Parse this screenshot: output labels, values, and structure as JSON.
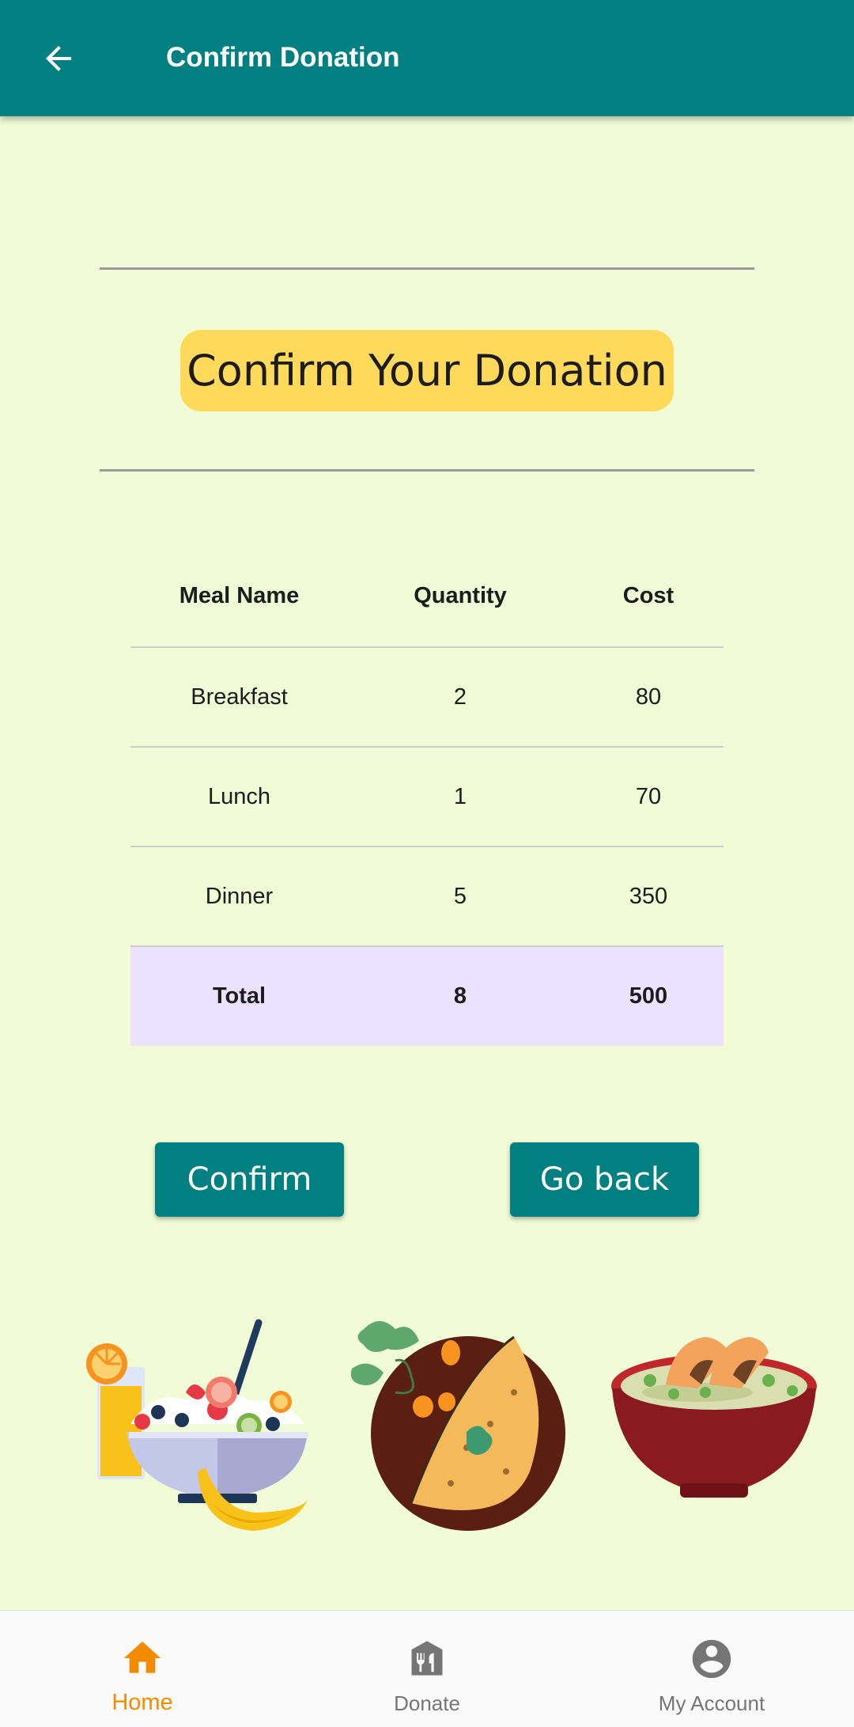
{
  "appbar": {
    "title": "Confirm Donation",
    "back_icon": "arrow-back-icon"
  },
  "heading": "Confirm Your Donation",
  "table": {
    "headers": [
      "Meal Name",
      "Quantity",
      "Cost"
    ],
    "rows": [
      [
        "Breakfast",
        "2",
        "80"
      ],
      [
        "Lunch",
        "1",
        "70"
      ],
      [
        "Dinner",
        "5",
        "350"
      ]
    ],
    "total": [
      "Total",
      "8",
      "500"
    ]
  },
  "buttons": {
    "confirm_label": "Confirm",
    "go_back_label": "Go back"
  },
  "illustrations": [
    "breakfast-bowl-illustration",
    "omelette-plate-illustration",
    "soup-bowl-illustration"
  ],
  "bottom_nav": {
    "items": [
      {
        "label": "Home",
        "icon": "home-icon",
        "active": true
      },
      {
        "label": "Donate",
        "icon": "restaurant-icon",
        "active": false
      },
      {
        "label": "My Account",
        "icon": "account-circle-icon",
        "active": false
      }
    ]
  },
  "colors": {
    "primary": "#008080",
    "background": "#f1fcd6",
    "heading_chip": "#ffd95a",
    "total_row": "#ebe2ff",
    "active_nav": "#f38b00",
    "inactive_nav": "#757575"
  }
}
